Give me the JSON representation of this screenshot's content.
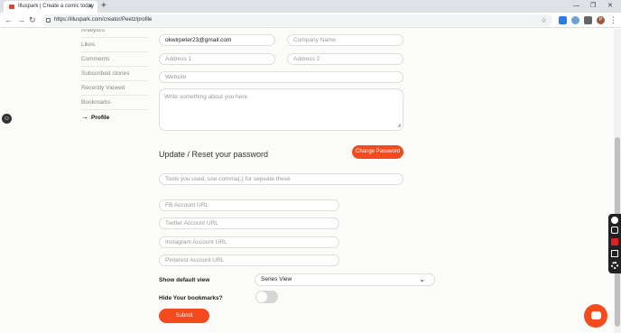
{
  "browser": {
    "tab_title": "Illuspark | Create a comic today",
    "new_tab": "+",
    "url": "https://illuspark.com/creator/Peetz/profile",
    "avatar_letter": "P"
  },
  "sidebar": {
    "items": [
      {
        "label": "Analytics"
      },
      {
        "label": "Likes"
      },
      {
        "label": "Comments"
      },
      {
        "label": "Subscribed stories"
      },
      {
        "label": "Recently Viewed"
      },
      {
        "label": "Bookmarks"
      },
      {
        "label": "Profile"
      }
    ],
    "active_arrow": "→"
  },
  "form": {
    "email_value": "okwirpeter23@gmail.com",
    "company_placeholder": "Company Name",
    "address1_placeholder": "Address 1",
    "address2_placeholder": "Address 2",
    "website_placeholder": "Website",
    "about_placeholder": "Write something about you here",
    "password_section_title": "Update / Reset your password",
    "change_password_label": "Change Password",
    "tools_placeholder": "Tools you used, use comma(,) for sepeate these",
    "fb_placeholder": "FB Account URL",
    "twitter_placeholder": "Twitter Account URL",
    "instagram_placeholder": "Instagram Account URL",
    "pinterest_placeholder": "Pinterest Account URL",
    "default_view_label": "Show default view",
    "default_view_value": "Series View",
    "hide_bookmarks_label": "Hide Your bookmarks?",
    "hide_bookmarks_on": false,
    "submit_label": "Submit"
  },
  "colors": {
    "accent": "#f44a1e"
  }
}
